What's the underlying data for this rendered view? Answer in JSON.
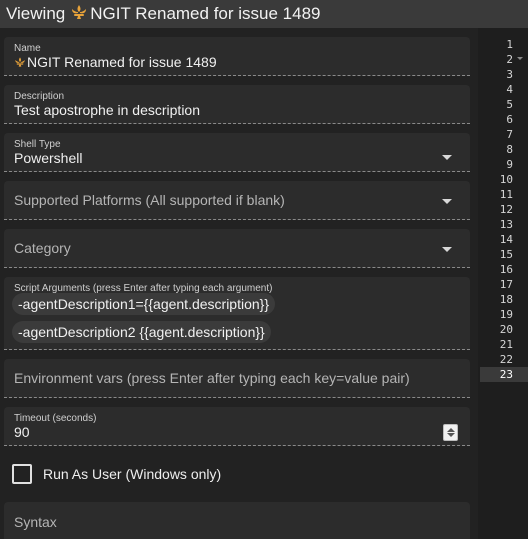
{
  "window": {
    "title_prefix": "Viewing ",
    "title_rest": "NGIT Renamed for issue 1489",
    "icon": "fleur-de-lis-icon"
  },
  "fields": {
    "name": {
      "label": "Name",
      "value": "NGIT Renamed for issue 1489"
    },
    "description": {
      "label": "Description",
      "value": "Test apostrophe in description"
    },
    "shell_type": {
      "label": "Shell Type",
      "value": "Powershell"
    },
    "supported_platforms": {
      "placeholder": "Supported Platforms (All supported if blank)"
    },
    "category": {
      "placeholder": "Category"
    },
    "script_arguments": {
      "label": "Script Arguments (press Enter after typing each argument)",
      "chips": [
        "-agentDescription1={{agent.description}}",
        "-agentDescription2 {{agent.description}}"
      ]
    },
    "env_vars": {
      "placeholder": "Environment vars (press Enter after typing each key=value pair)"
    },
    "timeout": {
      "label": "Timeout (seconds)",
      "value": "90"
    },
    "run_as_user": {
      "label": "Run As User (Windows only)",
      "checked": false
    },
    "syntax": {
      "placeholder": "Syntax"
    }
  },
  "editor": {
    "line_numbers": [
      "1",
      "2",
      "3",
      "4",
      "5",
      "6",
      "7",
      "8",
      "9",
      "10",
      "11",
      "12",
      "13",
      "14",
      "15",
      "16",
      "17",
      "18",
      "19",
      "20",
      "21",
      "22",
      "23"
    ],
    "active_line": "23"
  },
  "colors": {
    "accent_icon": "#e8a33a",
    "background": "#202020",
    "field_bg": "#2c2c2c"
  }
}
